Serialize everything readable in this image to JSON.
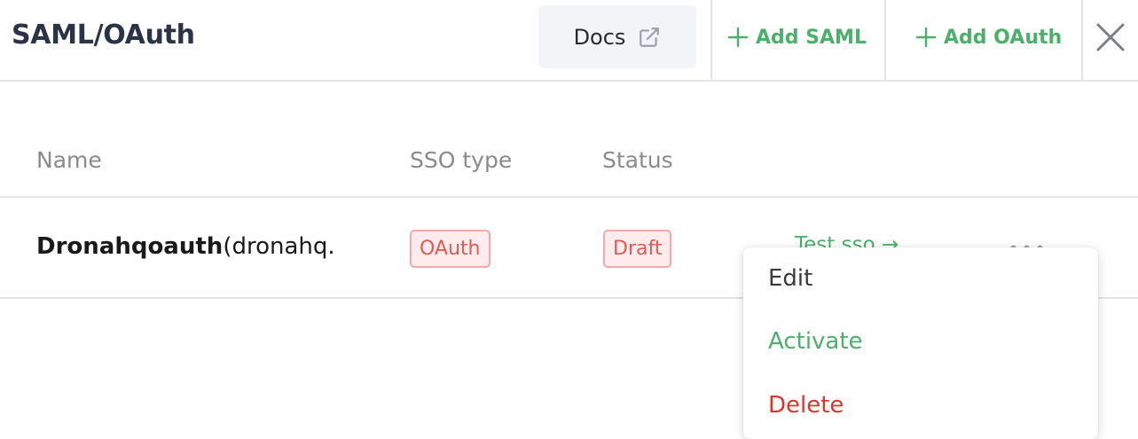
{
  "header": {
    "title": "SAML/OAuth",
    "docs_label": "Docs",
    "add_saml_label": "Add SAML",
    "add_oauth_label": "Add OAuth"
  },
  "table": {
    "columns": [
      "Name",
      "SSO type",
      "Status"
    ],
    "rows": [
      {
        "name_bold": "Dronahqoauth",
        "name_rest": "(dronahq.",
        "sso_type": "OAuth",
        "status": "Draft",
        "test_label": "Test sso →",
        "more_label": "•••"
      }
    ]
  },
  "menu": {
    "items": [
      "Edit",
      "Activate",
      "Delete"
    ]
  },
  "colors": {
    "accent_green": "#4caf6a",
    "danger_red": "#d9362e",
    "badge_bg": "#fdeceb",
    "badge_border": "#f3a9a9",
    "badge_text": "#e05a55"
  },
  "icons": {
    "docs": "external-link-icon",
    "add": "plus-icon",
    "close": "close-icon"
  }
}
